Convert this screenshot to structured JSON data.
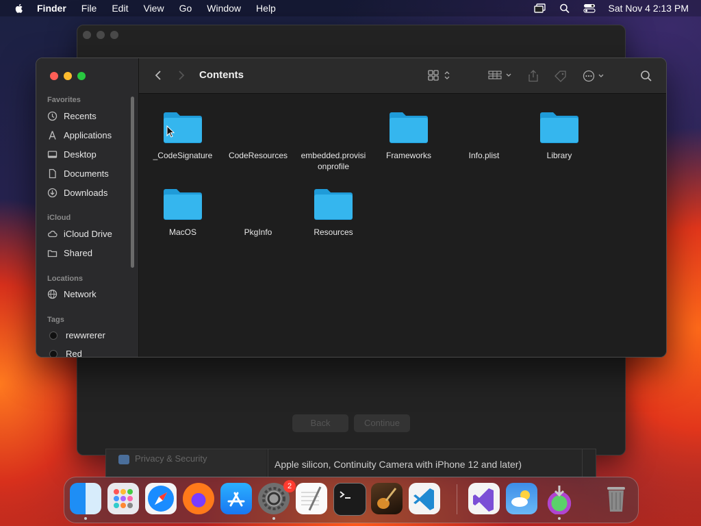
{
  "menubar": {
    "items": [
      "Finder",
      "File",
      "Edit",
      "View",
      "Go",
      "Window",
      "Help"
    ],
    "datetime": "Sat Nov 4  2:13 PM"
  },
  "background_window": {
    "back_button": "Back",
    "continue_button": "Continue",
    "sidebar_item": "Privacy & Security",
    "description": "Apple silicon, Continuity Camera with iPhone 12 and later)"
  },
  "finder": {
    "title": "Contents",
    "sidebar": {
      "favorites_header": "Favorites",
      "favorites": [
        "Recents",
        "Applications",
        "Desktop",
        "Documents",
        "Downloads"
      ],
      "icloud_header": "iCloud",
      "icloud": [
        "iCloud Drive",
        "Shared"
      ],
      "locations_header": "Locations",
      "locations": [
        "Network"
      ],
      "tags_header": "Tags",
      "tags": [
        "rewwrerer",
        "Red"
      ]
    },
    "files": [
      {
        "name": "_CodeSignature",
        "kind": "folder"
      },
      {
        "name": "CodeResources",
        "kind": "file"
      },
      {
        "name": "embedded.provisi onprofile",
        "kind": "file"
      },
      {
        "name": "Frameworks",
        "kind": "folder"
      },
      {
        "name": "Info.plist",
        "kind": "file"
      },
      {
        "name": "Library",
        "kind": "folder"
      },
      {
        "name": "MacOS",
        "kind": "folder"
      },
      {
        "name": "PkgInfo",
        "kind": "file"
      },
      {
        "name": "Resources",
        "kind": "folder"
      }
    ],
    "folder_color": "#35b6ee"
  },
  "dock": {
    "apps": [
      "finder-icon",
      "launchpad-icon",
      "safari-icon",
      "firefox-icon",
      "app-store-icon",
      "system-settings-icon",
      "textedit-icon",
      "terminal-icon",
      "garageband-icon",
      "vscode-icon",
      "visual-studio-icon",
      "weather-icon",
      "installer-icon",
      "trash-icon"
    ],
    "settings_badge": "2"
  }
}
